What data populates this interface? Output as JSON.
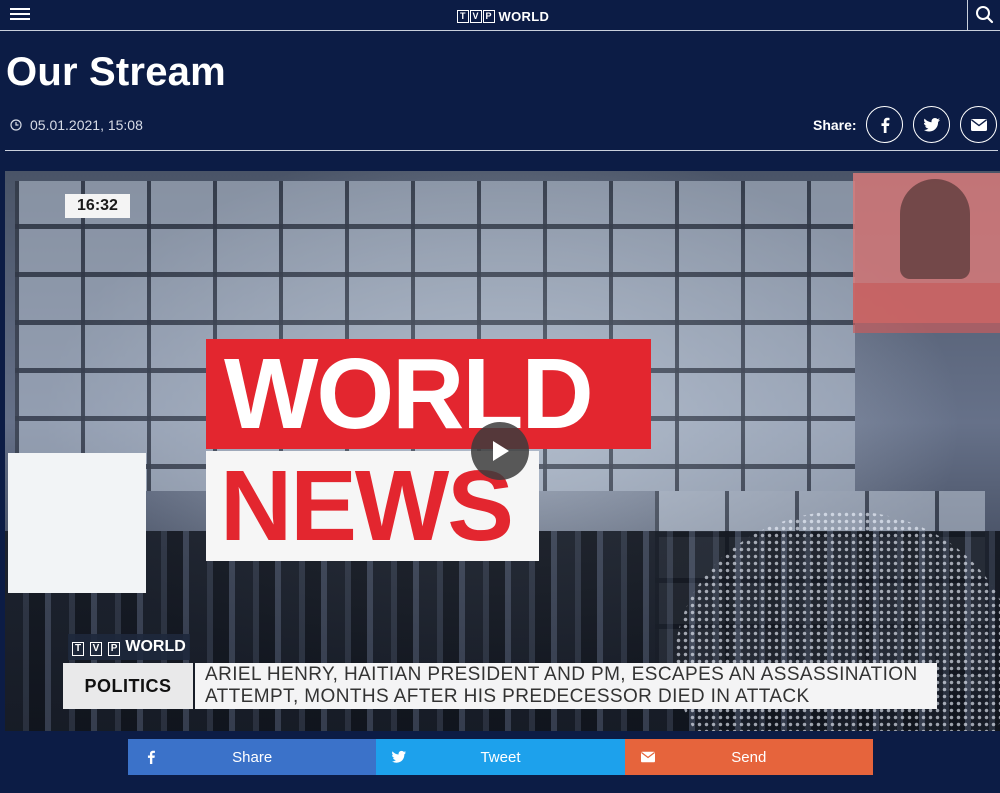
{
  "header": {
    "logo_letters": [
      "T",
      "V",
      "P"
    ],
    "logo_word": "WORLD",
    "menu_icon": "hamburger-icon",
    "search_icon": "search-icon"
  },
  "page": {
    "title": "Our Stream",
    "date": "05.01.2021, 15:08",
    "share_label": "Share:"
  },
  "share_icons": [
    "facebook-icon",
    "twitter-icon",
    "email-icon"
  ],
  "video": {
    "time": "16:32",
    "headline_line1": "WORLD",
    "headline_line2": "NEWS",
    "ticker_logo_letters": [
      "T",
      "V",
      "P"
    ],
    "ticker_logo_word": "WORLD",
    "ticker_category": "POLITICS",
    "ticker_text": "ARIEL HENRY, HAITIAN PRESIDENT AND PM, ESCAPES AN ASSASSINATION ATTEMPT, MONTHS AFTER HIS PREDECESSOR DIED IN ATTACK"
  },
  "share_bar": {
    "share": "Share",
    "tweet": "Tweet",
    "send": "Send"
  },
  "colors": {
    "background": "#0c1c45",
    "facebook": "#3b72c9",
    "twitter": "#1da1ec",
    "email": "#e6643c",
    "news_red": "#e3262f"
  }
}
